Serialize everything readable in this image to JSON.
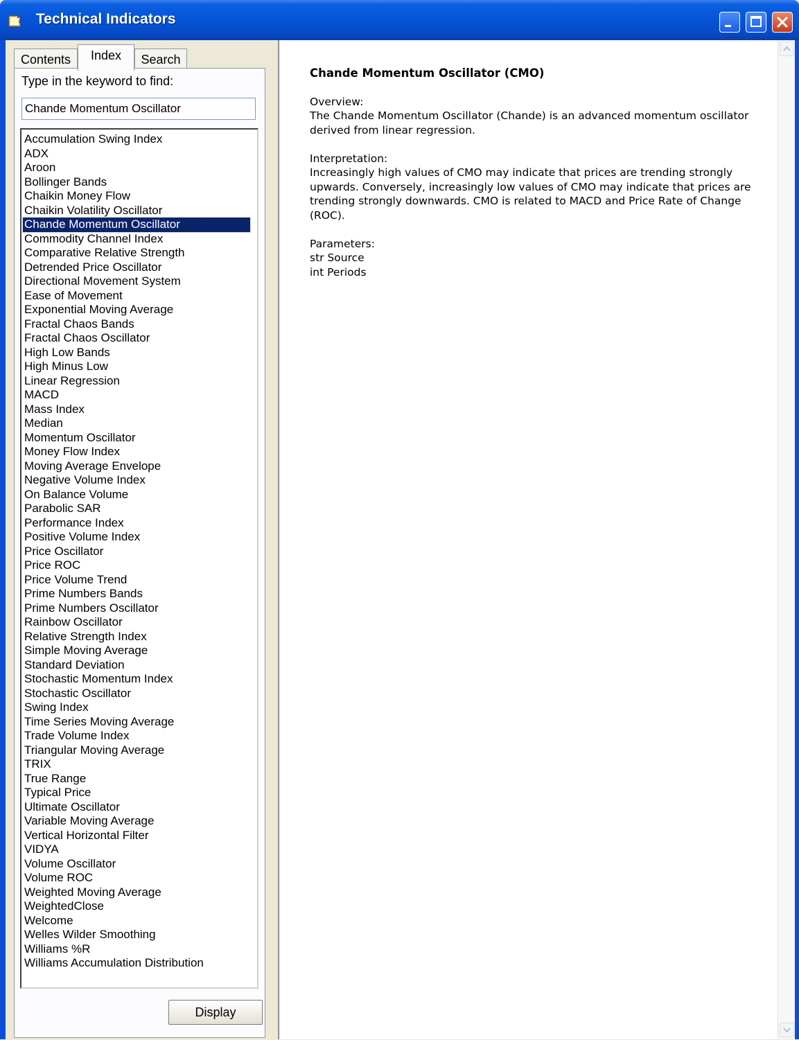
{
  "window": {
    "title": "Technical Indicators"
  },
  "tabs": [
    {
      "label": "Contents",
      "active": false
    },
    {
      "label": "Index",
      "active": true
    },
    {
      "label": "Search",
      "active": false
    }
  ],
  "index": {
    "keyword_label": "Type in the keyword to find:",
    "keyword_value": "Chande Momentum Oscillator",
    "selected_item": "Chande Momentum Oscillator",
    "items": [
      "Accumulation Swing Index",
      "ADX",
      "Aroon",
      "Bollinger Bands",
      "Chaikin Money Flow",
      "Chaikin Volatility Oscillator",
      "Chande Momentum Oscillator",
      "Commodity Channel Index",
      "Comparative Relative Strength",
      "Detrended Price Oscillator",
      "Directional Movement System",
      "Ease of Movement",
      "Exponential Moving Average",
      "Fractal Chaos Bands",
      "Fractal Chaos Oscillator",
      "High Low Bands",
      "High Minus Low",
      "Linear Regression",
      "MACD",
      "Mass Index",
      "Median",
      "Momentum Oscillator",
      "Money Flow Index",
      "Moving Average Envelope",
      "Negative Volume Index",
      "On Balance Volume",
      "Parabolic SAR",
      "Performance Index",
      "Positive Volume Index",
      "Price Oscillator",
      "Price ROC",
      "Price Volume Trend",
      "Prime Numbers Bands",
      "Prime Numbers Oscillator",
      "Rainbow Oscillator",
      "Relative Strength Index",
      "Simple Moving Average",
      "Standard Deviation",
      "Stochastic Momentum Index",
      "Stochastic Oscillator",
      "Swing Index",
      "Time Series Moving Average",
      "Trade Volume Index",
      "Triangular Moving Average",
      "TRIX",
      "True Range",
      "Typical Price",
      "Ultimate Oscillator",
      "Variable Moving Average",
      "Vertical Horizontal Filter",
      "VIDYA",
      "Volume Oscillator",
      "Volume ROC",
      "Weighted Moving Average",
      "WeightedClose",
      "Welcome",
      "Welles Wilder Smoothing",
      "Williams %R",
      "Williams Accumulation Distribution"
    ],
    "display_button": "Display"
  },
  "topic": {
    "title": "Chande Momentum Oscillator (CMO)",
    "overview_heading": "Overview:",
    "overview_text": "The Chande Momentum Oscillator (Chande) is an advanced momentum oscillator derived from linear regression.",
    "interpretation_heading": "Interpretation:",
    "interpretation_text": "Increasingly high values of CMO may indicate that prices are trending strongly upwards. Conversely, increasingly low values of CMO may indicate that prices are trending strongly downwards. CMO is related to MACD and Price Rate of Change (ROC).",
    "parameters_heading": "Parameters:",
    "parameters": [
      "str Source",
      "int Periods"
    ]
  },
  "colors": {
    "titlebar": "#0554d8",
    "selection": "#0a246a",
    "close_button": "#c8391a"
  }
}
